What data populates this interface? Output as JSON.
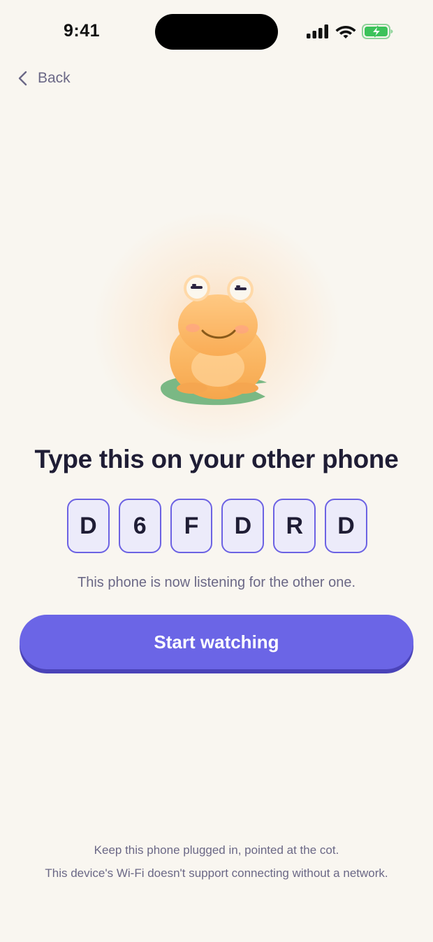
{
  "status_bar": {
    "time": "9:41",
    "icons": [
      "cellular-signal-icon",
      "wifi-icon",
      "battery-charging-icon"
    ]
  },
  "nav": {
    "back_label": "Back",
    "back_icon": "chevron-left-icon"
  },
  "mascot": {
    "name": "frog-mascot"
  },
  "headline": "Type this on your other phone",
  "code": [
    "D",
    "6",
    "F",
    "D",
    "R",
    "D"
  ],
  "listening_text": "This phone is now listening for the other one.",
  "primary_button": {
    "label": "Start watching"
  },
  "footer": {
    "note": "Keep this phone plugged in, pointed at the cot.",
    "warning": "This device's Wi-Fi doesn't support connecting without a network."
  },
  "colors": {
    "background": "#f9f6f0",
    "accent": "#6b65e6",
    "code_border": "#6c62e3",
    "code_fill": "#ecebfa",
    "text_primary": "#1f1d35",
    "text_secondary": "#6b6886"
  }
}
